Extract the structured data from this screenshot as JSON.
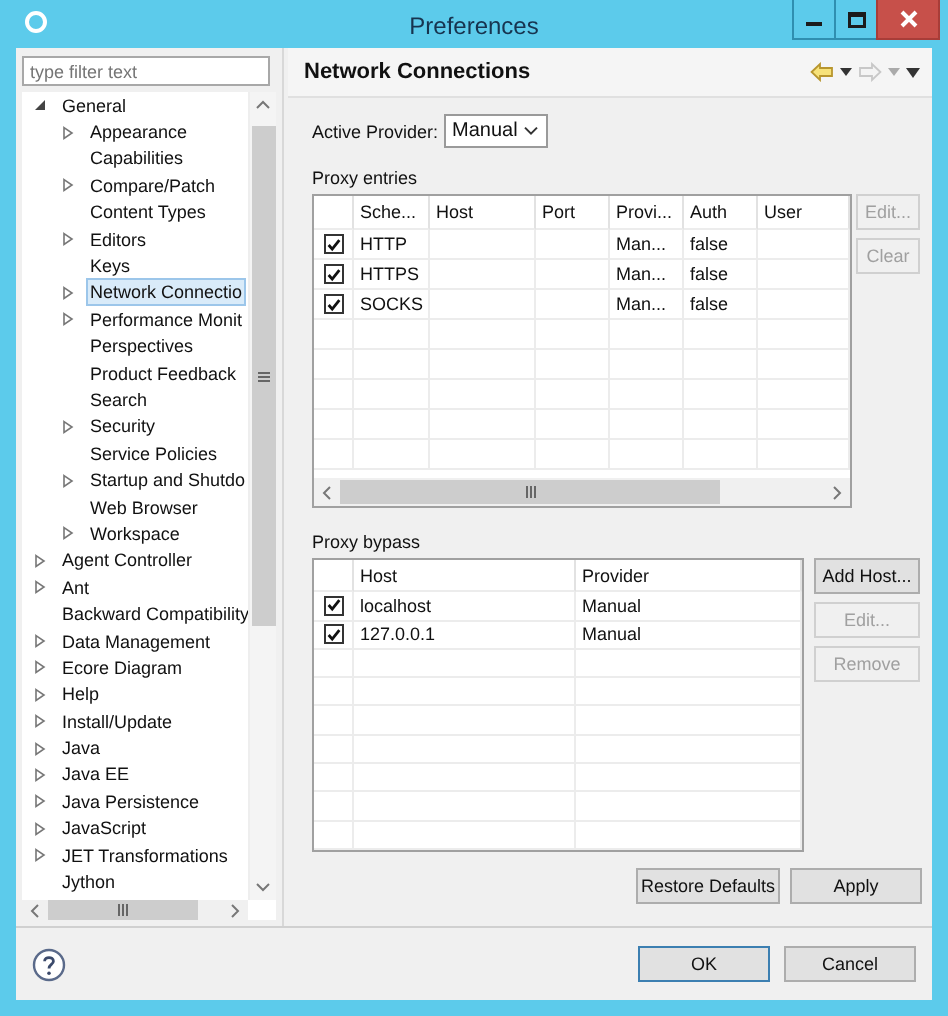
{
  "window": {
    "title": "Preferences"
  },
  "filter": {
    "placeholder": "type filter text"
  },
  "tree": [
    {
      "label": "General",
      "kind": "folder",
      "expanded": true,
      "selected": false,
      "children": [
        {
          "label": "Appearance",
          "kind": "folder",
          "expanded": false,
          "selected": false
        },
        {
          "label": "Capabilities",
          "kind": "leaf",
          "selected": false
        },
        {
          "label": "Compare/Patch",
          "kind": "folder",
          "expanded": false,
          "selected": false
        },
        {
          "label": "Content Types",
          "kind": "leaf",
          "selected": false
        },
        {
          "label": "Editors",
          "kind": "folder",
          "expanded": false,
          "selected": false
        },
        {
          "label": "Keys",
          "kind": "leaf",
          "selected": false
        },
        {
          "label": "Network Connectio",
          "kind": "folder",
          "expanded": false,
          "selected": true
        },
        {
          "label": "Performance Monit",
          "kind": "folder",
          "expanded": false,
          "selected": false
        },
        {
          "label": "Perspectives",
          "kind": "leaf",
          "selected": false
        },
        {
          "label": "Product Feedback",
          "kind": "leaf",
          "selected": false
        },
        {
          "label": "Search",
          "kind": "leaf",
          "selected": false
        },
        {
          "label": "Security",
          "kind": "folder",
          "expanded": false,
          "selected": false
        },
        {
          "label": "Service Policies",
          "kind": "leaf",
          "selected": false
        },
        {
          "label": "Startup and Shutdo",
          "kind": "folder",
          "expanded": false,
          "selected": false
        },
        {
          "label": "Web Browser",
          "kind": "leaf",
          "selected": false
        },
        {
          "label": "Workspace",
          "kind": "folder",
          "expanded": false,
          "selected": false
        }
      ]
    },
    {
      "label": "Agent Controller",
      "kind": "folder",
      "expanded": false,
      "selected": false
    },
    {
      "label": "Ant",
      "kind": "folder",
      "expanded": false,
      "selected": false
    },
    {
      "label": "Backward Compatibility",
      "kind": "leaf",
      "selected": false
    },
    {
      "label": "Data Management",
      "kind": "folder",
      "expanded": false,
      "selected": false
    },
    {
      "label": "Ecore Diagram",
      "kind": "folder",
      "expanded": false,
      "selected": false
    },
    {
      "label": "Help",
      "kind": "folder",
      "expanded": false,
      "selected": false
    },
    {
      "label": "Install/Update",
      "kind": "folder",
      "expanded": false,
      "selected": false
    },
    {
      "label": "Java",
      "kind": "folder",
      "expanded": false,
      "selected": false
    },
    {
      "label": "Java EE",
      "kind": "folder",
      "expanded": false,
      "selected": false
    },
    {
      "label": "Java Persistence",
      "kind": "folder",
      "expanded": false,
      "selected": false
    },
    {
      "label": "JavaScript",
      "kind": "folder",
      "expanded": false,
      "selected": false
    },
    {
      "label": "JET Transformations",
      "kind": "folder",
      "expanded": false,
      "selected": false
    },
    {
      "label": "Jython",
      "kind": "leaf",
      "selected": false
    }
  ],
  "page": {
    "title": "Network Connections"
  },
  "active_provider": {
    "label": "Active Provider:",
    "value": "Manual"
  },
  "proxy_entries": {
    "label": "Proxy entries",
    "columns": [
      "Sche...",
      "Host",
      "Port",
      "Provi...",
      "Auth",
      "User"
    ],
    "rows": [
      {
        "checked": true,
        "scheme": "HTTP",
        "provider": "Man...",
        "auth": "false"
      },
      {
        "checked": true,
        "scheme": "HTTPS",
        "provider": "Man...",
        "auth": "false"
      },
      {
        "checked": true,
        "scheme": "SOCKS",
        "provider": "Man...",
        "auth": "false"
      }
    ],
    "buttons": [
      {
        "label": "Edit...",
        "disabled": true
      },
      {
        "label": "Clear",
        "disabled": true
      }
    ]
  },
  "proxy_bypass": {
    "label": "Proxy bypass",
    "columns": [
      "Host",
      "Provider"
    ],
    "rows": [
      {
        "checked": true,
        "host": "localhost",
        "provider": "Manual"
      },
      {
        "checked": true,
        "host": "127.0.0.1",
        "provider": "Manual"
      }
    ],
    "buttons": [
      {
        "label": "Add Host...",
        "disabled": false
      },
      {
        "label": "Edit...",
        "disabled": true
      },
      {
        "label": "Remove",
        "disabled": true
      }
    ]
  },
  "page_buttons": [
    {
      "label": "Restore Defaults"
    },
    {
      "label": "Apply"
    }
  ],
  "dialog_buttons": [
    {
      "label": "OK",
      "default": true
    },
    {
      "label": "Cancel",
      "default": false
    }
  ]
}
